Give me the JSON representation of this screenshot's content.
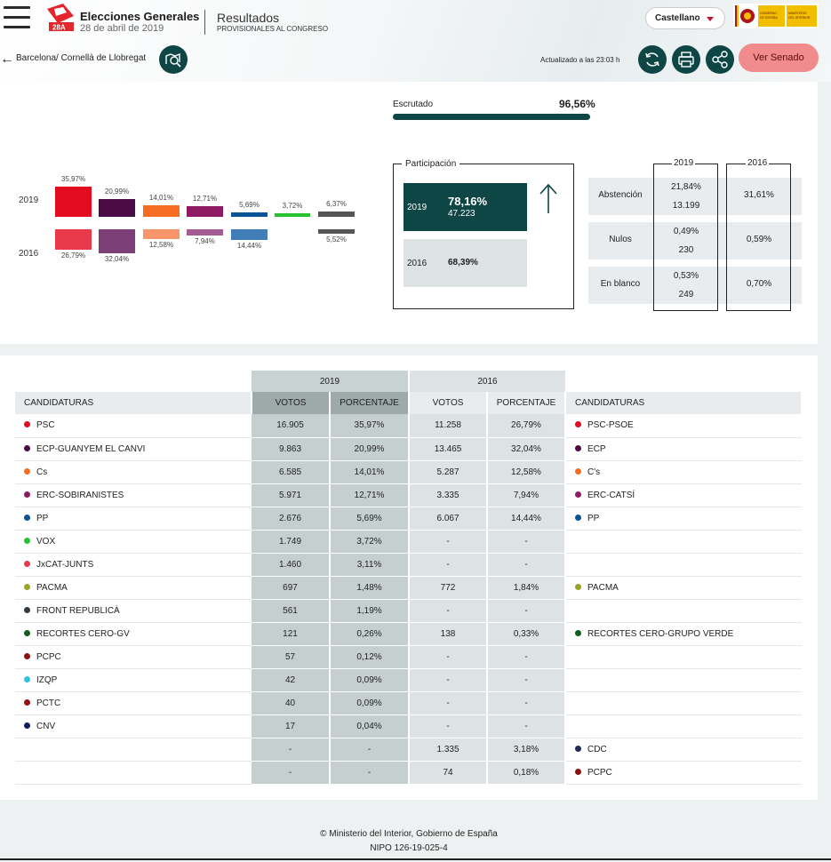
{
  "header": {
    "logo_badge": "28A",
    "title": "Elecciones Generales",
    "date": "28 de abril de 2019",
    "results_title": "Resultados",
    "results_subtitle": "PROVISIONALES AL CONGRESO",
    "language": "Castellano",
    "gov_logo_text_1": "GOBIERNO DE ESPAÑA",
    "gov_logo_text_2": "MINISTERIO DEL INTERIOR"
  },
  "toolbar": {
    "breadcrumb": "Barcelona/ Cornellà de Llobregat",
    "updated": "Actualizado a las 23:03 h",
    "senado_label": "Ver Senado"
  },
  "summary": {
    "escrutado_label": "Escrutado",
    "escrutado_value": "96,56%",
    "escrutado_fraction": 0.9656,
    "bars": {
      "years": [
        "2019",
        "2016"
      ],
      "parties_2019": [
        {
          "pct": "35,97%",
          "value": 35.97,
          "color": "#e20b20"
        },
        {
          "pct": "20,99%",
          "value": 20.99,
          "color": "#4b0b45"
        },
        {
          "pct": "14,01%",
          "value": 14.01,
          "color": "#f76c23"
        },
        {
          "pct": "12,71%",
          "value": 12.71,
          "color": "#8e1a63"
        },
        {
          "pct": "5,69%",
          "value": 5.69,
          "color": "#0a5398"
        },
        {
          "pct": "3,72%",
          "value": 3.72,
          "color": "#27c22f"
        },
        {
          "pct": "6,37%",
          "value": 6.37,
          "color": "#555555"
        }
      ],
      "parties_2016": [
        {
          "pct": "26,79%",
          "value": 26.79,
          "color": "#e83a4b"
        },
        {
          "pct": "32,04%",
          "value": 32.04,
          "color": "#7c3f78"
        },
        {
          "pct": "12,58%",
          "value": 12.58,
          "color": "#f8956a"
        },
        {
          "pct": "7,94%",
          "value": 7.94,
          "color": "#a45a93"
        },
        {
          "pct": "14,44%",
          "value": 14.44,
          "color": "#437db8"
        },
        {
          "pct": "",
          "value": 0,
          "color": "#ffffff"
        },
        {
          "pct": "5,52%",
          "value": 5.52,
          "color": "#555555"
        }
      ]
    },
    "participation": {
      "label": "Participación",
      "y2019": "2019",
      "pct2019": "78,16%",
      "votes2019": "47.223",
      "y2016": "2016",
      "pct2016": "68,39%"
    },
    "other": {
      "col_2019": "2019",
      "col_2016": "2016",
      "rows": [
        {
          "label": "Abstención",
          "v2019_pct": "21,84%",
          "v2019_votes": "13.199",
          "v2016": "31,61%"
        },
        {
          "label": "Nulos",
          "v2019_pct": "0,49%",
          "v2019_votes": "230",
          "v2016": "0,59%"
        },
        {
          "label": "En blanco",
          "v2019_pct": "0,53%",
          "v2019_votes": "249",
          "v2016": "0,70%"
        }
      ]
    }
  },
  "results": {
    "year_2019": "2019",
    "year_2016": "2016",
    "headers": {
      "candidaturas": "CANDIDATURAS",
      "votos": "VOTOS",
      "porcentaje": "PORCENTAJE"
    },
    "rows": [
      {
        "name": "PSC",
        "color": "#e20b20",
        "v19": "16.905",
        "p19": "35,97%",
        "v16": "11.258",
        "p16": "26,79%",
        "name16": "PSC-PSOE",
        "color16": "#e20b20"
      },
      {
        "name": "ECP-GUANYEM EL CANVI",
        "color": "#4b0b45",
        "v19": "9.863",
        "p19": "20,99%",
        "v16": "13.465",
        "p16": "32,04%",
        "name16": "ECP",
        "color16": "#4b0b45"
      },
      {
        "name": "Cs",
        "color": "#f76c23",
        "v19": "6.585",
        "p19": "14,01%",
        "v16": "5.287",
        "p16": "12,58%",
        "name16": "C's",
        "color16": "#f76c23"
      },
      {
        "name": "ERC-SOBIRANISTES",
        "color": "#8e1a63",
        "v19": "5.971",
        "p19": "12,71%",
        "v16": "3.335",
        "p16": "7,94%",
        "name16": "ERC-CATSÍ",
        "color16": "#8e1a63"
      },
      {
        "name": "PP",
        "color": "#0a5398",
        "v19": "2.676",
        "p19": "5,69%",
        "v16": "6.067",
        "p16": "14,44%",
        "name16": "PP",
        "color16": "#0a5398"
      },
      {
        "name": "VOX",
        "color": "#27c22f",
        "v19": "1.749",
        "p19": "3,72%",
        "v16": "-",
        "p16": "-",
        "name16": "",
        "color16": ""
      },
      {
        "name": "JxCAT-JUNTS",
        "color": "#e83a4b",
        "v19": "1.460",
        "p19": "3,11%",
        "v16": "-",
        "p16": "-",
        "name16": "",
        "color16": ""
      },
      {
        "name": "PACMA",
        "color": "#99a520",
        "v19": "697",
        "p19": "1,48%",
        "v16": "772",
        "p16": "1,84%",
        "name16": "PACMA",
        "color16": "#99a520"
      },
      {
        "name": "FRONT REPUBLICÀ",
        "color": "#2f3a44",
        "v19": "561",
        "p19": "1,19%",
        "v16": "-",
        "p16": "-",
        "name16": "",
        "color16": ""
      },
      {
        "name": "RECORTES CERO-GV",
        "color": "#0e5f1c",
        "v19": "121",
        "p19": "0,26%",
        "v16": "138",
        "p16": "0,33%",
        "name16": "RECORTES CERO-GRUPO VERDE",
        "color16": "#0e5f1c"
      },
      {
        "name": "PCPC",
        "color": "#8b1010",
        "v19": "57",
        "p19": "0,12%",
        "v16": "-",
        "p16": "-",
        "name16": "",
        "color16": ""
      },
      {
        "name": "IZQP",
        "color": "#2ec3e6",
        "v19": "42",
        "p19": "0,09%",
        "v16": "-",
        "p16": "-",
        "name16": "",
        "color16": ""
      },
      {
        "name": "PCTC",
        "color": "#9b1111",
        "v19": "40",
        "p19": "0,09%",
        "v16": "-",
        "p16": "-",
        "name16": "",
        "color16": ""
      },
      {
        "name": "CNV",
        "color": "#0c1d66",
        "v19": "17",
        "p19": "0,04%",
        "v16": "-",
        "p16": "-",
        "name16": "",
        "color16": ""
      },
      {
        "name": "",
        "color": "",
        "v19": "-",
        "p19": "-",
        "v16": "1.335",
        "p16": "3,18%",
        "name16": "CDC",
        "color16": "#1d2a5a"
      },
      {
        "name": "",
        "color": "",
        "v19": "-",
        "p19": "-",
        "v16": "74",
        "p16": "0,18%",
        "name16": "PCPC",
        "color16": "#8b1010"
      }
    ]
  },
  "footer": {
    "line1": "© Ministerio del Interior, Gobierno de España",
    "line2": "NIPO 126-19-025-4"
  }
}
